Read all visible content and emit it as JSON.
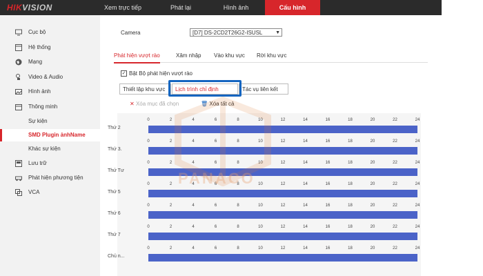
{
  "brand": {
    "prefix": "HIK",
    "rest": "VISION"
  },
  "topnav": [
    {
      "label": "Xem trực tiếp"
    },
    {
      "label": "Phát lại"
    },
    {
      "label": "Hình ảnh"
    },
    {
      "label": "Cấu hình"
    }
  ],
  "sidebar": [
    {
      "label": "Cục bộ",
      "icon": "monitor-icon"
    },
    {
      "label": "Hệ thống",
      "icon": "system-icon"
    },
    {
      "label": "Mạng",
      "icon": "globe-icon"
    },
    {
      "label": "Video & Audio",
      "icon": "audio-icon"
    },
    {
      "label": "Hình ảnh",
      "icon": "image-icon"
    },
    {
      "label": "Thông minh",
      "icon": "calendar-icon"
    },
    {
      "label": "Sự kiện",
      "icon": ""
    },
    {
      "label": "SMD Plugin ảnhName",
      "icon": ""
    },
    {
      "label": "Khác sự kiện",
      "icon": ""
    },
    {
      "label": "Lưu trữ",
      "icon": "storage-icon"
    },
    {
      "label": "Phát hiện phương tiện",
      "icon": "vehicle-icon"
    },
    {
      "label": "VCA",
      "icon": "vca-icon"
    }
  ],
  "camera": {
    "label": "Camera",
    "value": "[D7] DS-2CD2T26G2-ISUSL"
  },
  "tabs": [
    {
      "label": "Phát hiện vượt rào"
    },
    {
      "label": "Xâm nhập"
    },
    {
      "label": "Vào khu vực"
    },
    {
      "label": "Rời khu vực"
    }
  ],
  "enable": {
    "label": "Bật Bộ phát hiện vượt rào",
    "checked": true
  },
  "subtabs": [
    {
      "label": "Thiết lập khu vực"
    },
    {
      "label": "Lịch trình chỉ định"
    },
    {
      "label": "Tác vụ liên kết"
    }
  ],
  "actions": {
    "delete_selected": "Xóa mục đã chọn",
    "delete_all": "Xóa tất cả"
  },
  "schedule": {
    "hours": [
      "0",
      "2",
      "4",
      "6",
      "8",
      "10",
      "12",
      "14",
      "16",
      "18",
      "20",
      "22",
      "24"
    ],
    "days": [
      "Thứ 2",
      "Thứ 3.",
      "Thứ Tư",
      "Thứ 5",
      "Thứ 6",
      "Thứ 7",
      "Chủ n..."
    ],
    "coverage": [
      [
        0,
        24
      ],
      [
        0,
        24
      ],
      [
        0,
        24
      ],
      [
        0,
        24
      ],
      [
        0,
        24
      ],
      [
        0,
        24
      ],
      [
        0,
        24
      ]
    ]
  },
  "watermark": "PANACO",
  "colors": {
    "accent": "#d7262b",
    "bar": "#4b63c8",
    "highlight": "#1565c0"
  }
}
